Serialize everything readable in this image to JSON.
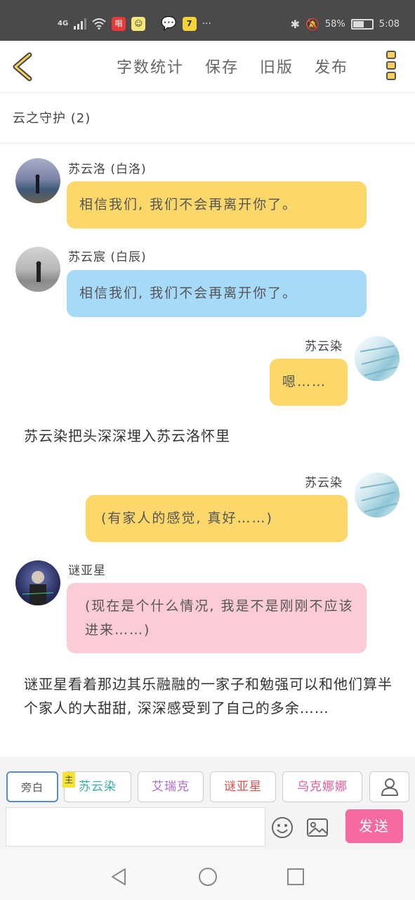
{
  "status_bar": {
    "signal": "4G",
    "app_badge_1": "唱",
    "notification_badge": "7",
    "more": "···",
    "battery_text": "58%",
    "battery_level": 0.58,
    "time": "5:08"
  },
  "top_bar": {
    "word_count": "字数统计",
    "save": "保存",
    "old_version": "旧版",
    "publish": "发布"
  },
  "group": {
    "title": "云之守护 (2)"
  },
  "messages": [
    {
      "speaker": "苏云洛 (白洛)",
      "text": "相信我们, 我们不会再离开你了。",
      "bubble_color": "#fcd86a"
    },
    {
      "speaker": "苏云宸 (白辰)",
      "text": "相信我们, 我们不会再离开你了。",
      "bubble_color": "#a6daf8"
    },
    {
      "speaker": "苏云染",
      "text": "嗯……",
      "bubble_color": "#fcd86a"
    },
    {
      "narration": "苏云染把头深深埋入苏云洛怀里"
    },
    {
      "speaker": "苏云染",
      "text": "(有家人的感觉, 真好……)",
      "bubble_color": "#fcd86a"
    },
    {
      "speaker": "谜亚星",
      "text": "(现在是个什么情况, 我是不是刚刚不应该进来……)",
      "bubble_color": "#fccbd8"
    },
    {
      "narration": "谜亚星看着那边其乐融融的一家子和勉强可以和他们算半个家人的大甜甜, 深深感受到了自己的多余……"
    }
  ],
  "character_tabs": {
    "narration": "旁白",
    "main_tag": "主",
    "char_1": "苏云染",
    "char_2": "艾瑞克",
    "char_3": "谜亚星",
    "char_4": "乌克娜娜"
  },
  "colors": {
    "accent_pink": "#f56aa0",
    "yellow_bubble": "#fcd86a",
    "blue_bubble": "#a6daf8",
    "pink_bubble": "#fccbd8",
    "char_1_color": "#3ab0a8",
    "char_2_color": "#b06ad0",
    "char_3_color": "#e0504a",
    "char_4_color": "#e05a9a"
  },
  "composer": {
    "input_value": "",
    "send_label": "发送"
  },
  "icons": {
    "back": "chevron-left-icon",
    "more": "more-vertical-icon",
    "add_character": "person-icon",
    "emoji": "emoji-icon",
    "image": "image-icon"
  }
}
